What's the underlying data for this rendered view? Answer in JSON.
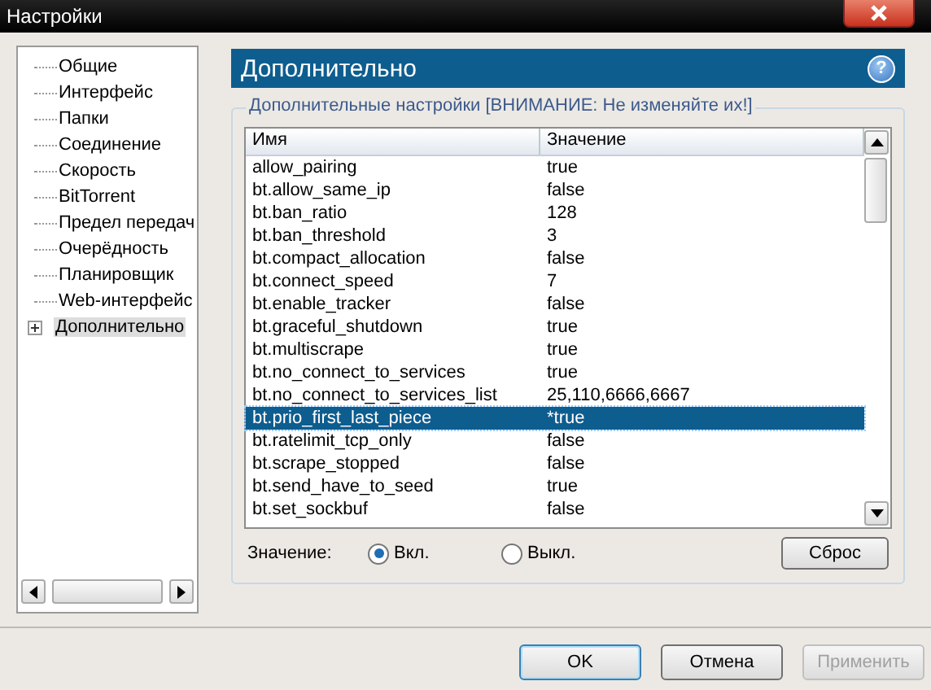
{
  "window": {
    "title": "Настройки"
  },
  "sidebar": {
    "items": [
      {
        "label": "Общие",
        "selected": false,
        "expandable": false
      },
      {
        "label": "Интерфейс",
        "selected": false,
        "expandable": false
      },
      {
        "label": "Папки",
        "selected": false,
        "expandable": false
      },
      {
        "label": "Соединение",
        "selected": false,
        "expandable": false
      },
      {
        "label": "Скорость",
        "selected": false,
        "expandable": false
      },
      {
        "label": "BitTorrent",
        "selected": false,
        "expandable": false
      },
      {
        "label": "Предел передач",
        "selected": false,
        "expandable": false
      },
      {
        "label": "Очерёдность",
        "selected": false,
        "expandable": false
      },
      {
        "label": "Планировщик",
        "selected": false,
        "expandable": false
      },
      {
        "label": "Web-интерфейс",
        "selected": false,
        "expandable": false
      },
      {
        "label": "Дополнительно",
        "selected": true,
        "expandable": true
      }
    ]
  },
  "panel": {
    "title": "Дополнительно",
    "help": "?",
    "group_title": "Дополнительные настройки [ВНИМАНИЕ: Не изменяйте их!]"
  },
  "table": {
    "columns": [
      "Имя",
      "Значение"
    ],
    "rows": [
      {
        "name": "allow_pairing",
        "value": "true",
        "selected": false
      },
      {
        "name": "bt.allow_same_ip",
        "value": "false",
        "selected": false
      },
      {
        "name": "bt.ban_ratio",
        "value": "128",
        "selected": false
      },
      {
        "name": "bt.ban_threshold",
        "value": "3",
        "selected": false
      },
      {
        "name": "bt.compact_allocation",
        "value": "false",
        "selected": false
      },
      {
        "name": "bt.connect_speed",
        "value": "7",
        "selected": false
      },
      {
        "name": "bt.enable_tracker",
        "value": "false",
        "selected": false
      },
      {
        "name": "bt.graceful_shutdown",
        "value": "true",
        "selected": false
      },
      {
        "name": "bt.multiscrape",
        "value": "true",
        "selected": false
      },
      {
        "name": "bt.no_connect_to_services",
        "value": "true",
        "selected": false
      },
      {
        "name": "bt.no_connect_to_services_list",
        "value": "25,110,6666,6667",
        "selected": false
      },
      {
        "name": "bt.prio_first_last_piece",
        "value": "*true",
        "selected": true
      },
      {
        "name": "bt.ratelimit_tcp_only",
        "value": "false",
        "selected": false
      },
      {
        "name": "bt.scrape_stopped",
        "value": "false",
        "selected": false
      },
      {
        "name": "bt.send_have_to_seed",
        "value": "true",
        "selected": false
      },
      {
        "name": "bt.set_sockbuf",
        "value": "false",
        "selected": false
      }
    ]
  },
  "value_field": {
    "label": "Значение:",
    "options": [
      {
        "label": "Вкл.",
        "selected": true
      },
      {
        "label": "Выкл.",
        "selected": false
      }
    ],
    "reset": "Сброс"
  },
  "buttons": [
    {
      "label": "OK",
      "default": true,
      "disabled": false
    },
    {
      "label": "Отмена",
      "default": false,
      "disabled": false
    },
    {
      "label": "Применить",
      "default": false,
      "disabled": true
    }
  ]
}
